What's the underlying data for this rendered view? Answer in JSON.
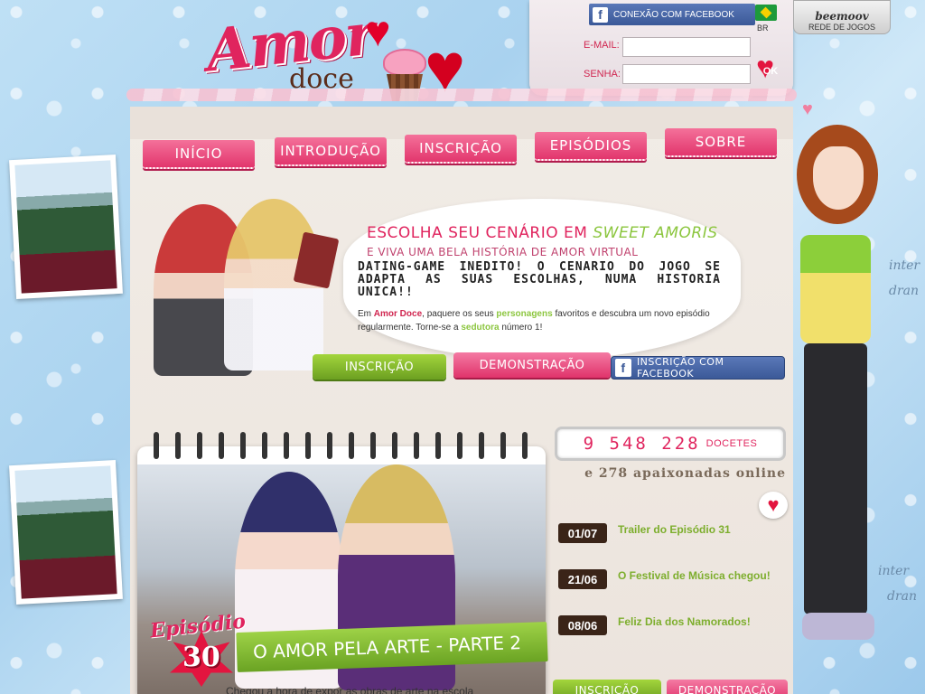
{
  "logo": {
    "amor": "Amor",
    "doce": "doce"
  },
  "login": {
    "facebook_connect": "CONEXÃO COM FACEBOOK",
    "lang": "BR",
    "email_label": "E-MAIL:",
    "password_label": "SENHA:",
    "ok_label": "OK"
  },
  "beemoov": {
    "logo": "beemoov",
    "tagline": "REDE DE JOGOS"
  },
  "nav": {
    "inicio": "Início",
    "introducao": "Introdução",
    "inscricao": "Inscrição",
    "episodios": "Episódios",
    "sobre": "Sobre"
  },
  "hero": {
    "headline_prefix": "ESCOLHA SEU CENÁRIO EM ",
    "headline_game": "SWEET AMORIS",
    "subheadline": "E VIVA UMA BELA HISTÓRIA DE AMOR VIRTUAL",
    "tagline": "DATING-GAME INEDITO! O CENARIO DO JOGO SE ADAPTA AS SUAS ESCOLHAS, NUMA HISTORIA UNICA!!",
    "p_1": "Em ",
    "p_brand": "Amor Doce",
    "p_2": ", paquere os seus ",
    "p_personagens": "personagens",
    "p_3": " favoritos e descubra um novo episódio regularmente. Torne-se a ",
    "p_sedutora": "sedutora",
    "p_4": " número 1!"
  },
  "buttons": {
    "inscricao": "Inscrição",
    "demonstracao": "Demonstração",
    "facebook_signup": "INSCRIÇÃO COM FACEBOOK"
  },
  "episode": {
    "word": "Episódio",
    "number": "30",
    "title": "O AMOR PELA ARTE - PARTE 2",
    "desc": "Chegou a hora de expor as obras de arte na escola"
  },
  "stats": {
    "count": "9 548 228",
    "count_label": "DOCETES",
    "online": "e 278 apaixonadas online"
  },
  "news": [
    {
      "date": "01/07",
      "title": "Trailer do Episódio 31"
    },
    {
      "date": "21/06",
      "title": "O Festival de Música chegou!"
    },
    {
      "date": "08/06",
      "title": "Feliz Dia dos Namorados!"
    }
  ],
  "decor": {
    "winter_1": "inter",
    "winter_1b": "dran",
    "winter_2": "inter",
    "winter_2b": "dran"
  }
}
